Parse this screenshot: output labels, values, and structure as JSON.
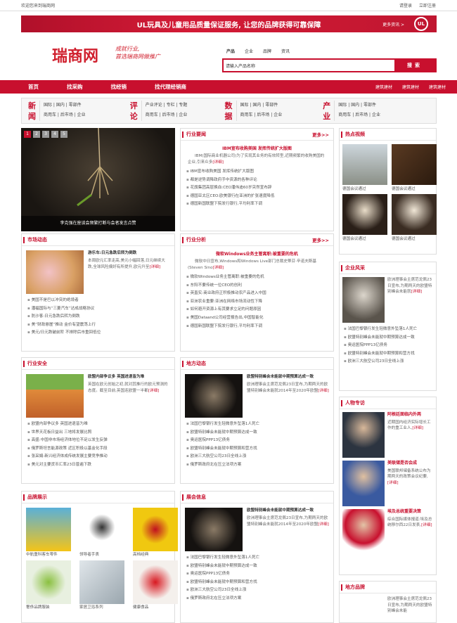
{
  "topbar": {
    "welcome": "欢迎您来到瑞商网",
    "login": "请登录",
    "register": "立即注册"
  },
  "banner": {
    "text": "UL玩具及儿童用品质量保证服务, 让您的品牌获得可靠保障",
    "more": "更多资讯 >",
    "badge": "UL"
  },
  "logo": {
    "text": "瑞商网",
    "slogan1": "成就行业,",
    "slogan2": "首选瑞商网做推广"
  },
  "search": {
    "tabs": [
      "产品",
      "企业",
      "品牌",
      "资讯"
    ],
    "placeholder": "请输入产品名称",
    "button": "搜索"
  },
  "nav": {
    "items": [
      "首页",
      "找采购",
      "找经销",
      "找代理经销商"
    ],
    "right": [
      "建筑建材",
      "建筑建材",
      "建筑建材"
    ]
  },
  "cats": [
    {
      "big1": "新",
      "big2": "闻",
      "l1": "国际 | 国内 | 零部件",
      "l2": "商用车 | 后市场 | 企业"
    },
    {
      "big1": "评",
      "big2": "论",
      "l1": "产业评论 | 专栏 | 专题",
      "l2": "商用车 | 后市场 | 企业"
    },
    {
      "big1": "数",
      "big2": "据",
      "l1": "国际 | 国内 | 零部件",
      "l2": "商用车 | 后市场 | 企业"
    },
    {
      "big1": "产",
      "big2": "业",
      "l1": "国际 | 国内 | 零部件",
      "l2": "商用车 | 后市场 | 企业"
    }
  ],
  "slider": {
    "caption": "李克强在座谈会频繁打断与会者发言点赞",
    "pages": [
      "1",
      "2",
      "3",
      "4",
      "5"
    ]
  },
  "hot": {
    "title": "行业要闻",
    "more": "更多>>",
    "lead_title": "IBM宣布收购美国 发挥传统扩大版图",
    "lead_text": "IBM(国际商业机器公司)为了实现其业务的有效转型,近期频繁的收购美国的企业,引来众多",
    "detail": "[详细]",
    "items": [
      "IBM宣布收购美国 发挥传统扩大版图",
      "都是逆势调降政府手中资源的各种评论",
      "花旗集团高层换血:CEO潘伟迪60岁突然宣布辞",
      "德国亚太区CEO:欧美银行在亚洲的扩张速度降低",
      "德国新国联盟下院发行银行,平均利率下调"
    ]
  },
  "video": {
    "title": "热点视频",
    "items": [
      "德国会议通过",
      "德国会议通过",
      "德国会议通过",
      "德国会议通过"
    ]
  },
  "market": {
    "title": "市场动态",
    "lead_title": "游乐车:日元急跌后转为倒跌",
    "lead_text": "本周欧元汇率走高,美元小幅回落,日元继续大跌,全球风险偏好有所提升,欧元升至",
    "detail": "[详细]",
    "items": [
      "美国不是巴以冲突的绝境者",
      "潘福国际与“三菱汽车”达成战略协议",
      "防沙客:日元急跌后转为倒跌",
      "美“财政悬崖”推动 金价有望震荡上行",
      "美元/日元跌破前阶 不排除后市重回低位"
    ]
  },
  "analysis": {
    "title": "行业分析",
    "more": "更多>>",
    "lead_title": "微软Windows业务主管离职:被重要的危机",
    "lead_text": "微软中日宣布,Windows和Windows Live部门总裁史蒂芬·辛诺夫斯基(Steven Sino",
    "detail": "[详细]",
    "items": [
      "微软Windows业务主管离职:被重要的危机",
      "东阳不要传统一位CEO的创利",
      "英直实:商业政府正积极推动农产品进入中国",
      "亚洲农业重要:亚洲在网络市场流动性下降",
      "如何避开资源上有其要求立足的问题原因",
      "美国Dataand公司经营报告出,中国智能化",
      "德国新国联盟下院发行银行,平均利率下调"
    ]
  },
  "company": {
    "title": "企业风采",
    "lead_text": "欧洲理事会主席范龙佩23日宣布,为期两天的欧盟特别峰会未能就",
    "detail": "[详细]",
    "items": [
      "法国巴黎银行发生轻微意外坠落1人死亡",
      "欧盟特别峰会未能就中期预算达成一致",
      "奥运医院PPP13亿债务",
      "欧盟特别峰会未能就中期预算和营方找",
      "欧洲三大航空公司23日全线上涨"
    ]
  },
  "safety": {
    "title": "行业安全",
    "lead_title": "欧盟内部争议多 英国进退皆为难",
    "lead_text": "英国在欧元创始之初,就对其推行的欧元预测的态度。截至目前,英国连欧盟一半都",
    "detail": "[详细]",
    "items": [
      "欧盟内部争议多 英国进退皆为难",
      "世界天花板日益出 三地将发展比照",
      "高盛:中国非市场经济体地位不足以发生反弹",
      "俄罗斯坦言能源政策 近区积极以基金化手段",
      "张采娟:新兴经济体成传统发展主要竞争推动",
      "美元对主要货币汇率23日普遍下跌"
    ]
  },
  "local": {
    "title": "地方动态",
    "lead_title": "欧盟特别峰会未能就中期预算达成一致",
    "lead_text": "欧洲理事会主席范龙佩23日宣布,为期两天的欧盟特别峰会未能就2014年至2020年欧盟",
    "detail": "[详细]",
    "items": [
      "法国巴黎银行发生轻微意外坠落1人死亡",
      "欧盟特别峰会未能就中期预算达成一致",
      "奥运医院PPP13亿债务",
      "欧盟特别峰会未能就中期预算和营方找",
      "欧洲三大航空公司23日全线上涨",
      "俄罗斯政府北在压立法项方案"
    ]
  },
  "people": {
    "title": "人物专访",
    "items": [
      {
        "name": "阿根廷面临内外两",
        "text": "近期国内经济实际增长工作的重工业人,",
        "detail": "[详细]"
      },
      {
        "name": "美联储是否会成",
        "text": "美国联邦储备系统公布为期两天的政策会议纪要,",
        "detail": "[详细]"
      },
      {
        "name": "埃及总统重要决策",
        "text": "综合国际媒体报道:埃及总统穆尔西22日发表,",
        "detail": "[详细]"
      }
    ]
  },
  "products": {
    "title": "品牌展示",
    "items": [
      "中航重科客车零件",
      "领导者手表",
      "高档经典",
      "奢侈品牌服装",
      "家居卫浴系列",
      "健康食品"
    ]
  },
  "expo": {
    "title": "展会信息",
    "lead_title": "欧盟特别峰会未能就中期预算达成一致",
    "lead_text": "欧洲理事会主席范龙佩23日宣布,为期两天的欧盟特别峰会未能就2014年至2020年欧盟",
    "detail": "[详细]",
    "items": [
      "法国巴黎银行发生轻微意外坠落1人死亡",
      "欧盟特别峰会未能就中期预算达成一致",
      "奥运医院PPP13亿债务",
      "欧盟特别峰会未能就中期预算和营方找",
      "欧洲三大航空公司23日全线上涨",
      "俄罗斯政府北在压立法项方案"
    ]
  },
  "brands": {
    "title": "地方品牌",
    "lead_text": "欧洲理事会主席范龙佩23日宣布,为期两天的欧盟特别峰会未能"
  }
}
